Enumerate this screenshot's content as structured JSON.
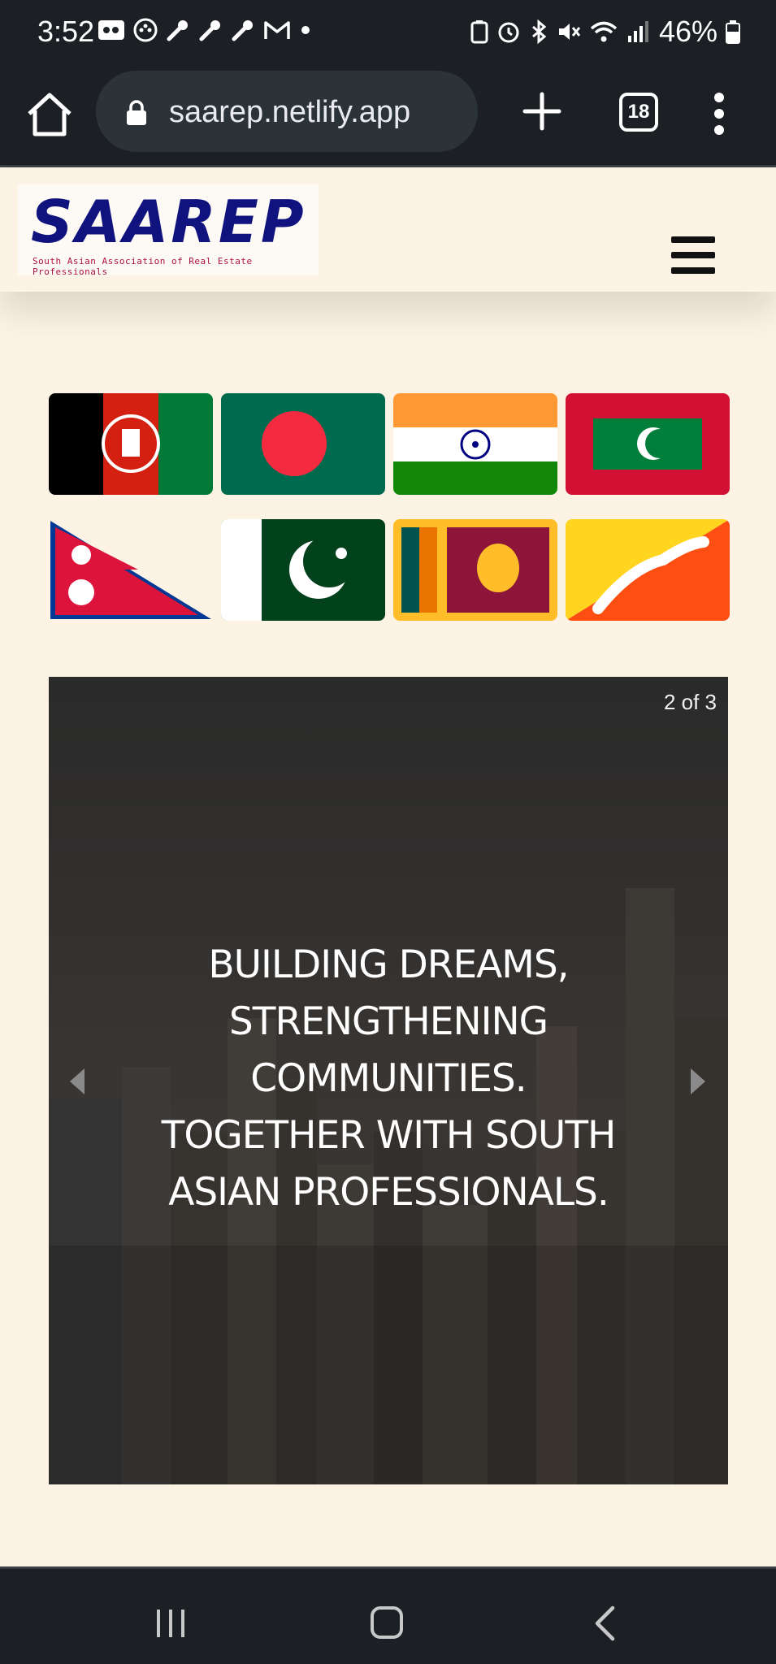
{
  "status_bar": {
    "time": "3:52",
    "battery": "46%",
    "left_icons": [
      "voicemail-icon",
      "chat-icon",
      "wrench-icon",
      "wrench-icon",
      "wrench-icon",
      "gmail-icon",
      "dot-icon"
    ],
    "right_icons": [
      "battery-saver-icon",
      "alarm-icon",
      "bluetooth-icon",
      "mute-icon",
      "wifi-icon",
      "signal-icon",
      "battery-icon"
    ]
  },
  "browser": {
    "url": "saarep.netlify.app",
    "tab_count": "18"
  },
  "site": {
    "logo_word": "SAAREP",
    "logo_tagline": "South Asian Association of Real Estate Professionals",
    "flags": [
      "Afghanistan",
      "Bangladesh",
      "India",
      "Maldives",
      "Nepal",
      "Pakistan",
      "Sri Lanka",
      "Bhutan"
    ]
  },
  "carousel": {
    "counter": "2 of 3",
    "line1": "BUILDING DREAMS,",
    "line2": "STRENGTHENING",
    "line3": "COMMUNITIES.",
    "line4": "TOGETHER WITH SOUTH",
    "line5": "ASIAN PROFESSIONALS."
  },
  "colors": {
    "page_bg": "#fdf3e4",
    "chrome_bg": "#1c2024",
    "logo_blue": "#10127e"
  }
}
